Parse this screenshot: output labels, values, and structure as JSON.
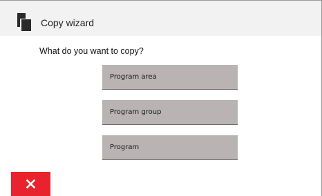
{
  "window": {
    "title": "Copy wizard",
    "icon": "copy-documents-icon"
  },
  "prompt": "What do you want to copy?",
  "choices": [
    {
      "label": "Program area"
    },
    {
      "label": "Program group"
    },
    {
      "label": "Program"
    }
  ],
  "cancel": {
    "icon": "close-x-icon",
    "color": "#e8232d"
  },
  "colors": {
    "choice_background": "#b9b3b4",
    "titlebar_background": "#f2f2f2"
  }
}
